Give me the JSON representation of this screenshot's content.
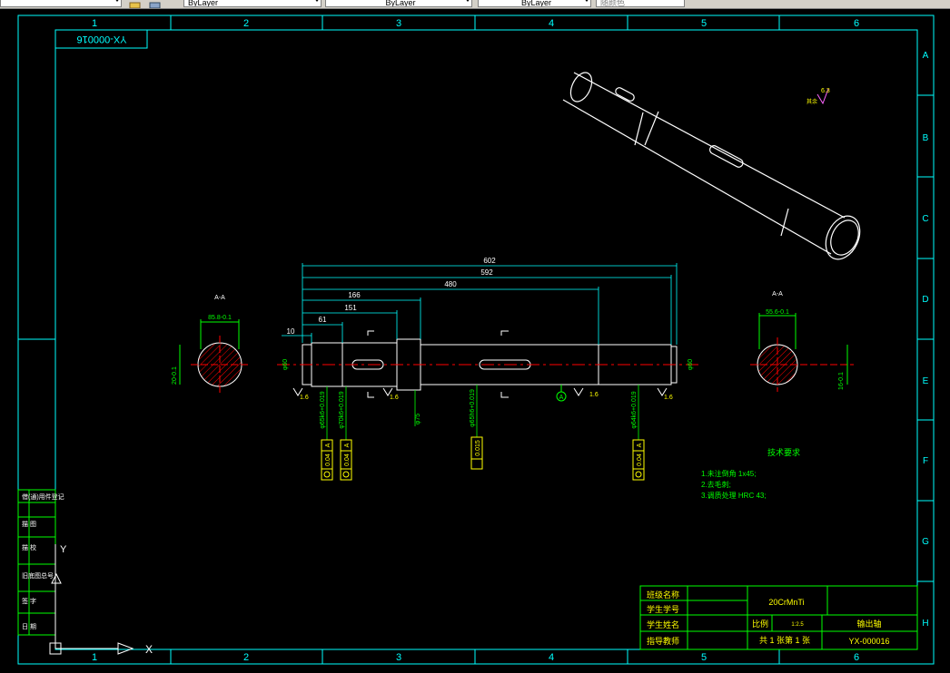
{
  "toolbar": {
    "linetype": "ByLayer",
    "lineweight": "ByLayer",
    "color": "ByLayer",
    "plotstyle": "随颜色",
    "icons": [
      "layer-manager-icon",
      "layer-states-icon"
    ]
  },
  "border": {
    "cols": [
      "1",
      "2",
      "3",
      "4",
      "5",
      "6"
    ],
    "rows": [
      "A",
      "B",
      "C",
      "D",
      "E",
      "F",
      "G",
      "H"
    ]
  },
  "drawing_number_rotated": "YX-000016",
  "dimensions": {
    "d602": "602",
    "d592": "592",
    "d480": "480",
    "d166": "166",
    "d151": "151",
    "d61": "61",
    "d10": "10",
    "d60_left": "φ60",
    "d60_right": "φ60",
    "d75": "φ75",
    "d65": "φ65k6+0.019",
    "d70": "φ70k6+0.019",
    "d65b": "φ65h6+0.019",
    "d64": "φ64k6+0.019",
    "sec_left_width": "85.8-0.1",
    "sec_right_width": "55.6-0.1",
    "sec_left_depth": "20-0.1",
    "sec_right_depth": "16-0.1",
    "sec_label": "A-A",
    "rough_1": "1.6",
    "rough_2": "1.6",
    "rough_3": "1.6",
    "rough_4": "1.6",
    "rough_5": "1.6",
    "roughness_top": "6.3"
  },
  "tolerances": {
    "t1": "0.04",
    "t1_ref": "A",
    "t2": "0.04",
    "t2_ref": "A",
    "t3": "0.015",
    "t4": "0.04",
    "t4_ref": "A",
    "datum": "A"
  },
  "tech_req": {
    "title": "技术要求",
    "lines": [
      "1.未注倒角 1x45;",
      "2.去毛刺;",
      "3.调质处理 HRC 43;"
    ]
  },
  "title_block": {
    "r1": "班级名称",
    "r2": "学生学号",
    "r3": "学生姓名",
    "r4": "指导教师",
    "material": "20CrMnTi",
    "scale_label": "比例",
    "scale_value": "1:2.5",
    "part_name": "输出轴",
    "sheet_info": "共 1 张第 1 张",
    "drawing_number": "YX-000016"
  },
  "left_strip": [
    "借(通)用件登记",
    "描 图",
    "描 校",
    "旧底图总号",
    "签 字",
    "日 期"
  ],
  "rough_sym_label": "其余"
}
